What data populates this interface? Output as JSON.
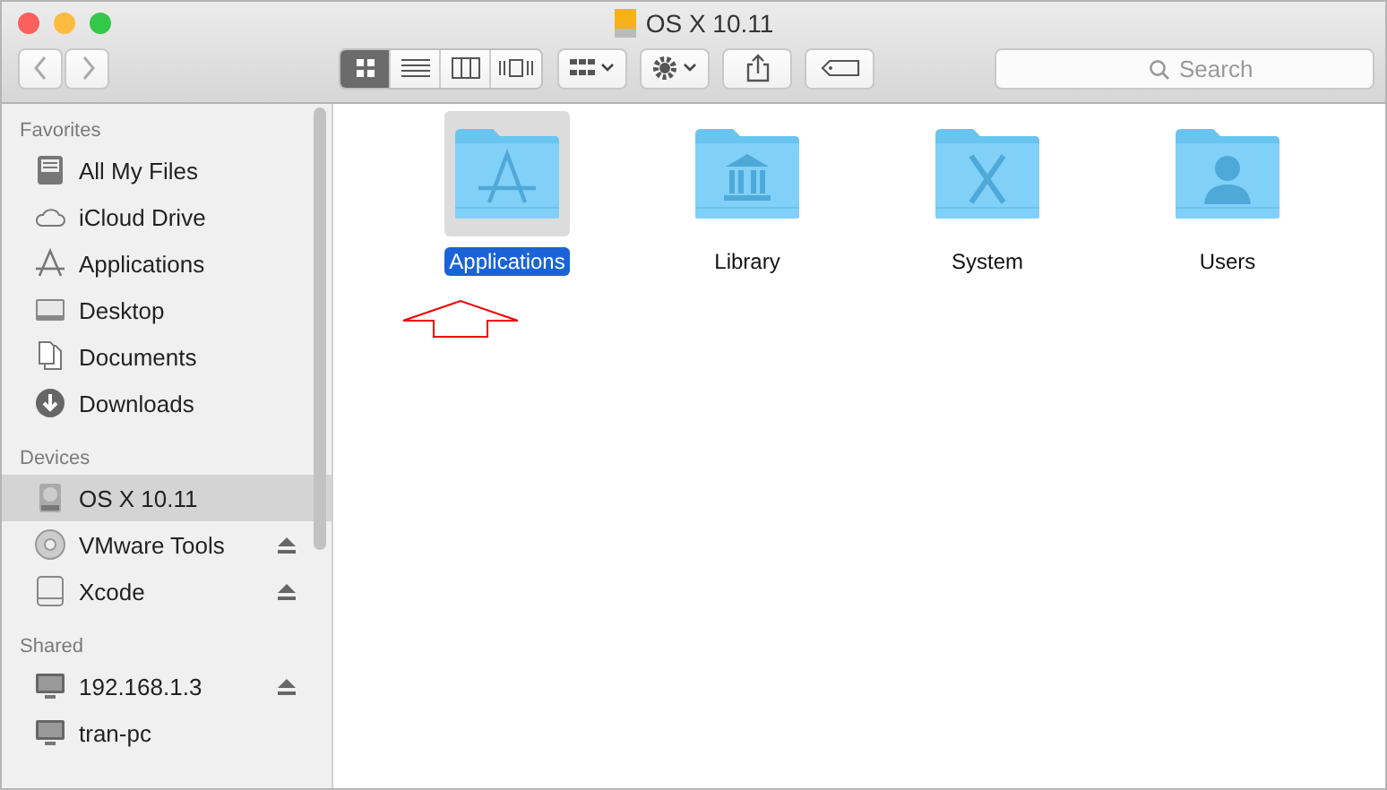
{
  "window": {
    "title": "OS X 10.11"
  },
  "toolbar": {
    "view_buttons": [
      {
        "kind": "icons",
        "selected": true
      },
      {
        "kind": "list",
        "selected": false
      },
      {
        "kind": "columns",
        "selected": false
      },
      {
        "kind": "coverflow",
        "selected": false
      }
    ],
    "search": {
      "placeholder": "Search"
    }
  },
  "sidebar": {
    "sections": [
      {
        "heading": "Favorites",
        "items": [
          {
            "label": "All My Files",
            "kind": "files",
            "selected": false,
            "eject": false
          },
          {
            "label": "iCloud Drive",
            "kind": "cloud",
            "selected": false,
            "eject": false
          },
          {
            "label": "Applications",
            "kind": "apps",
            "selected": false,
            "eject": false
          },
          {
            "label": "Desktop",
            "kind": "desktop",
            "selected": false,
            "eject": false
          },
          {
            "label": "Documents",
            "kind": "documents",
            "selected": false,
            "eject": false
          },
          {
            "label": "Downloads",
            "kind": "downloads",
            "selected": false,
            "eject": false
          }
        ]
      },
      {
        "heading": "Devices",
        "items": [
          {
            "label": "OS X 10.11",
            "kind": "disk",
            "selected": true,
            "eject": false
          },
          {
            "label": "VMware Tools",
            "kind": "disc",
            "selected": false,
            "eject": true
          },
          {
            "label": "Xcode",
            "kind": "volume",
            "selected": false,
            "eject": true
          }
        ]
      },
      {
        "heading": "Shared",
        "items": [
          {
            "label": "192.168.1.3",
            "kind": "computer",
            "selected": false,
            "eject": true
          },
          {
            "label": "tran-pc",
            "kind": "computer",
            "selected": false,
            "eject": false
          }
        ]
      }
    ]
  },
  "folders": [
    {
      "name": "Applications",
      "kind": "apps",
      "selected": true
    },
    {
      "name": "Library",
      "kind": "library",
      "selected": false
    },
    {
      "name": "System",
      "kind": "system",
      "selected": false
    },
    {
      "name": "Users",
      "kind": "users",
      "selected": false
    }
  ]
}
